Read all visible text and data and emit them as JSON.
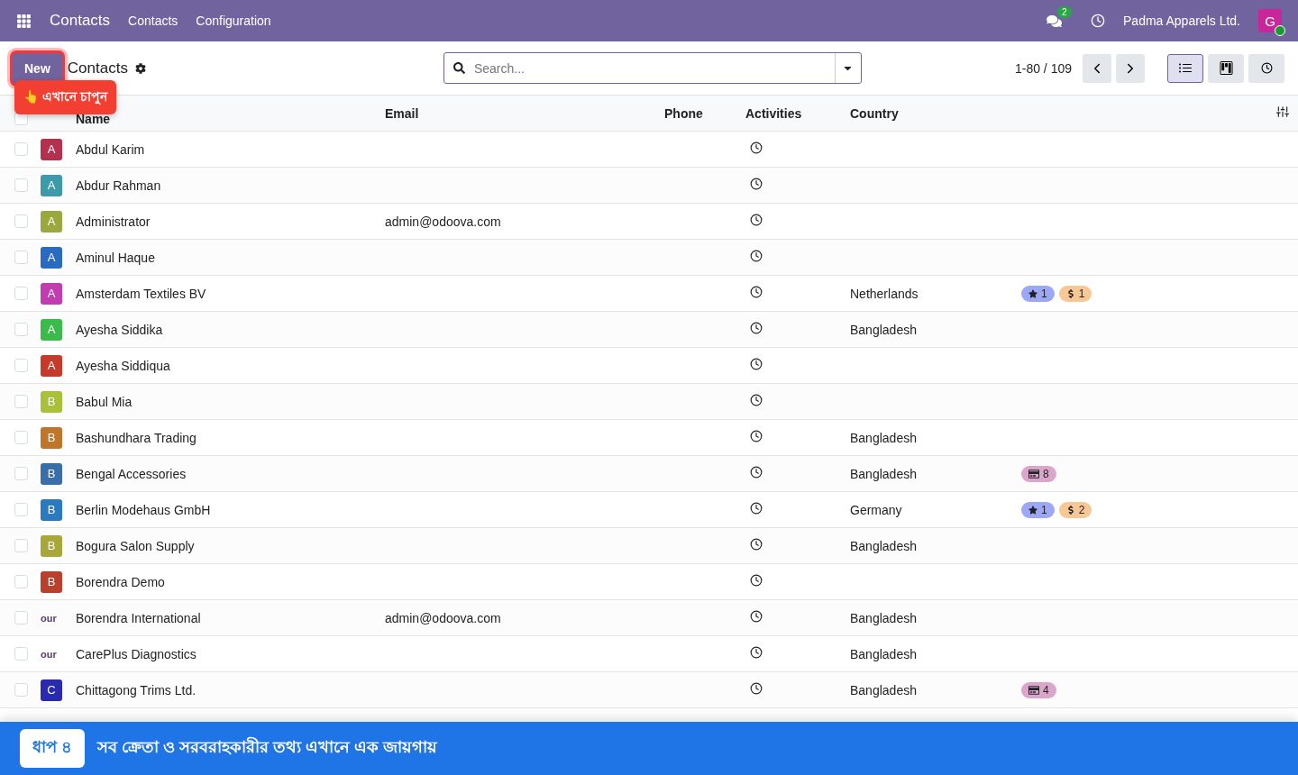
{
  "navbar": {
    "app_title": "Contacts",
    "menu": [
      "Contacts",
      "Configuration"
    ],
    "messages_count": "2",
    "company": "Padma Apparels Ltd.",
    "avatar_letter": "G"
  },
  "control_panel": {
    "new_button": "New",
    "title": "Contacts",
    "search": {
      "placeholder": "Search..."
    },
    "pager": "1-80 / 109",
    "views": [
      {
        "kind": "list",
        "selected": true
      },
      {
        "kind": "kanban",
        "selected": false
      },
      {
        "kind": "activity",
        "selected": false
      }
    ]
  },
  "tooltip": "👆 এখানে চাপুন",
  "table": {
    "select_all_checked": false,
    "columns": [
      "Name",
      "Email",
      "Phone",
      "Activities",
      "Country"
    ],
    "rows": [
      {
        "checked": false,
        "avatar": {
          "kind": "letter",
          "text": "A",
          "color": "#b5304c"
        },
        "name": "Abdul Karim"
      },
      {
        "checked": false,
        "avatar": {
          "kind": "letter",
          "text": "A",
          "color": "#3d9aa8"
        },
        "name": "Abdur Rahman"
      },
      {
        "checked": false,
        "avatar": {
          "kind": "letter",
          "text": "A",
          "color": "#9aa83d"
        },
        "name": "Administrator",
        "email": "admin@odoova.com"
      },
      {
        "checked": false,
        "avatar": {
          "kind": "letter",
          "text": "A",
          "color": "#2a6ac0"
        },
        "name": "Aminul Haque"
      },
      {
        "checked": false,
        "avatar": {
          "kind": "letter",
          "text": "A",
          "color": "#c03cb0"
        },
        "name": "Amsterdam Textiles BV",
        "country": "Netherlands",
        "tags": [
          {
            "kind": "star",
            "text": "1",
            "color": "#9ca8f5"
          },
          {
            "kind": "dollar",
            "text": "1",
            "color": "#f7c896"
          }
        ]
      },
      {
        "checked": false,
        "avatar": {
          "kind": "letter",
          "text": "A",
          "color": "#3cba4c"
        },
        "name": "Ayesha Siddika",
        "country": "Bangladesh"
      },
      {
        "checked": false,
        "avatar": {
          "kind": "letter",
          "text": "A",
          "color": "#c63a2c"
        },
        "name": "Ayesha Siddiqua"
      },
      {
        "checked": false,
        "avatar": {
          "kind": "letter",
          "text": "B",
          "color": "#a8c03a"
        },
        "name": "Babul Mia"
      },
      {
        "checked": false,
        "avatar": {
          "kind": "letter",
          "text": "B",
          "color": "#c0762a"
        },
        "name": "Bashundhara Trading",
        "country": "Bangladesh"
      },
      {
        "checked": false,
        "avatar": {
          "kind": "letter",
          "text": "B",
          "color": "#3a6ea8"
        },
        "name": "Bengal Accessories",
        "country": "Bangladesh",
        "tags": [
          {
            "kind": "card",
            "text": "8",
            "color": "#dca6cc"
          }
        ]
      },
      {
        "checked": false,
        "avatar": {
          "kind": "letter",
          "text": "B",
          "color": "#2a7ac0"
        },
        "name": "Berlin Modehaus GmbH",
        "country": "Germany",
        "tags": [
          {
            "kind": "star",
            "text": "1",
            "color": "#9ca8f5"
          },
          {
            "kind": "dollar",
            "text": "2",
            "color": "#f7c896"
          }
        ]
      },
      {
        "checked": false,
        "avatar": {
          "kind": "letter",
          "text": "B",
          "color": "#a8a83a"
        },
        "name": "Bogura Salon Supply",
        "country": "Bangladesh"
      },
      {
        "checked": false,
        "avatar": {
          "kind": "letter",
          "text": "B",
          "color": "#b8402c"
        },
        "name": "Borendra Demo"
      },
      {
        "checked": false,
        "avatar": {
          "kind": "logo",
          "text": "our"
        },
        "name": "Borendra International",
        "email": "admin@odoova.com",
        "country": "Bangladesh"
      },
      {
        "checked": false,
        "avatar": {
          "kind": "logo",
          "text": "our"
        },
        "name": "CarePlus Diagnostics",
        "country": "Bangladesh"
      },
      {
        "checked": false,
        "avatar": {
          "kind": "letter",
          "text": "C",
          "color": "#2a2ab0"
        },
        "name": "Chittagong Trims Ltd.",
        "country": "Bangladesh",
        "tags": [
          {
            "kind": "card",
            "text": "4",
            "color": "#dca6cc"
          }
        ]
      }
    ]
  },
  "banner": {
    "step": "ধাপ ৪",
    "text": "সব ক্রেতা ও সরবরাহকারীর তথ্য এখানে এক জায়গায়"
  }
}
